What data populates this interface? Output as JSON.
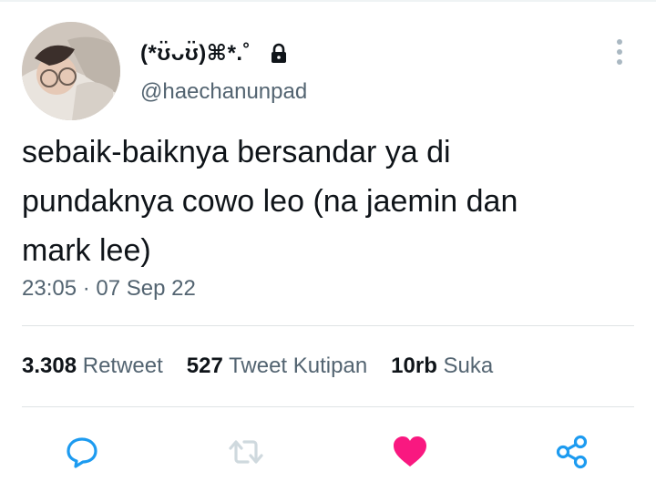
{
  "user": {
    "display_name": "(*ʊ̈ᴗʊ̈)⌘*.˚",
    "handle": "@haechanunpad",
    "protected_icon": "lock-icon"
  },
  "tweet": {
    "text": "sebaik-baiknya bersandar ya di\npundaknya cowo leo (na jaemin dan\nmark lee)",
    "timestamp": "23:05 · 07 Sep 22",
    "liked": true
  },
  "stats": {
    "retweets_count": "3.308",
    "retweets_label": "Retweet",
    "quotes_count": "527",
    "quotes_label": "Tweet Kutipan",
    "likes_count": "10rb",
    "likes_label": "Suka"
  },
  "actions": [
    "reply-icon",
    "retweet-icon",
    "like-icon",
    "share-icon"
  ],
  "colors": {
    "text": "#0f1419",
    "secondary": "#536471",
    "like": "#f91880",
    "icon": "#1d9bf0",
    "retweet_icon": "#cfd9de"
  }
}
